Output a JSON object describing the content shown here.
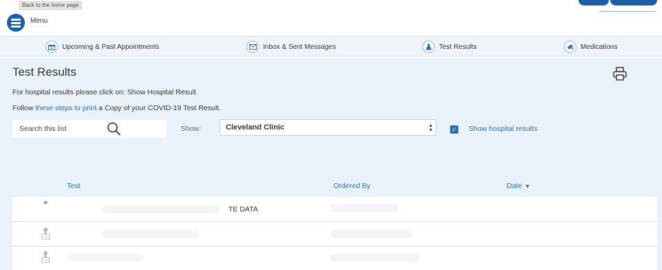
{
  "header": {
    "tooltip": "Back to the home page",
    "menu_label": "Menu"
  },
  "nav": {
    "items": [
      {
        "label": "Upcoming & Past Appointments",
        "icon": "calendar-icon"
      },
      {
        "label": "Inbox & Sent Messages",
        "icon": "envelope-icon"
      },
      {
        "label": "Test Results",
        "icon": "flask-icon"
      },
      {
        "label": "Medications",
        "icon": "pills-icon"
      }
    ]
  },
  "main": {
    "title": "Test Results",
    "hospital_note": "For hospital results please click on: Show Hospital Result",
    "follow_prefix": "Follow",
    "follow_link": "these steps to print",
    "follow_suffix": "a Copy of your COVID-19 Test Result.",
    "search_placeholder": "Search this list",
    "show_label": "Show:",
    "show_selected": "Cleveland Clinic",
    "show_hospital_checked": true,
    "show_hospital_label": "Show hospital results"
  },
  "table": {
    "columns": {
      "test": "Test",
      "ordered_by": "Ordered By",
      "date": "Date"
    },
    "sort_indicator": "▼",
    "rows": [
      {
        "visible_text": "TE DATA"
      },
      {
        "visible_text": ""
      },
      {
        "visible_text": ""
      }
    ]
  },
  "colors": {
    "accent": "#2d6fb3",
    "panel_bg": "#e9f1f9",
    "nav_bg": "#eef4fa"
  }
}
